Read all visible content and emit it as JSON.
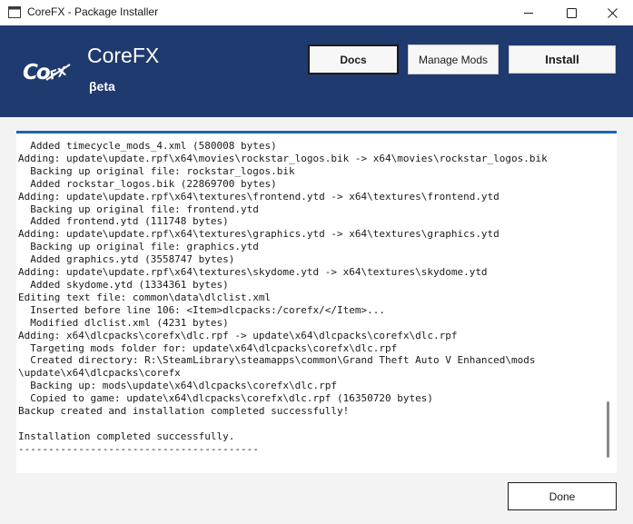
{
  "window": {
    "title": "CoreFX - Package Installer",
    "controls": [
      "minimize",
      "maximize",
      "close"
    ]
  },
  "header": {
    "logo_text": "CoFX",
    "app_name": "CoreFX",
    "app_subtitle": "βeta",
    "background": "#1f3a6e",
    "buttons": {
      "docs": "Docs",
      "manage_mods": "Manage Mods",
      "install": "Install"
    }
  },
  "log": {
    "accent": "#1f63b4",
    "lines": [
      "  Added timecycle_mods_4.xml (580008 bytes)",
      "Adding: update\\update.rpf\\x64\\movies\\rockstar_logos.bik -> x64\\movies\\rockstar_logos.bik",
      "  Backing up original file: rockstar_logos.bik",
      "  Added rockstar_logos.bik (22869700 bytes)",
      "Adding: update\\update.rpf\\x64\\textures\\frontend.ytd -> x64\\textures\\frontend.ytd",
      "  Backing up original file: frontend.ytd",
      "  Added frontend.ytd (111748 bytes)",
      "Adding: update\\update.rpf\\x64\\textures\\graphics.ytd -> x64\\textures\\graphics.ytd",
      "  Backing up original file: graphics.ytd",
      "  Added graphics.ytd (3558747 bytes)",
      "Adding: update\\update.rpf\\x64\\textures\\skydome.ytd -> x64\\textures\\skydome.ytd",
      "  Added skydome.ytd (1334361 bytes)",
      "Editing text file: common\\data\\dlclist.xml",
      "  Inserted before line 106: <Item>dlcpacks:/corefx/</Item>...",
      "  Modified dlclist.xml (4231 bytes)",
      "Adding: x64\\dlcpacks\\corefx\\dlc.rpf -> update\\x64\\dlcpacks\\corefx\\dlc.rpf",
      "  Targeting mods folder for: update\\x64\\dlcpacks\\corefx\\dlc.rpf",
      "  Created directory: R:\\SteamLibrary\\steamapps\\common\\Grand Theft Auto V Enhanced\\mods",
      "\\update\\x64\\dlcpacks\\corefx",
      "  Backing up: mods\\update\\x64\\dlcpacks\\corefx\\dlc.rpf",
      "  Copied to game: update\\x64\\dlcpacks\\corefx\\dlc.rpf (16350720 bytes)",
      "Backup created and installation completed successfully!",
      "",
      "Installation completed successfully.",
      "----------------------------------------"
    ]
  },
  "footer": {
    "done": "Done"
  }
}
